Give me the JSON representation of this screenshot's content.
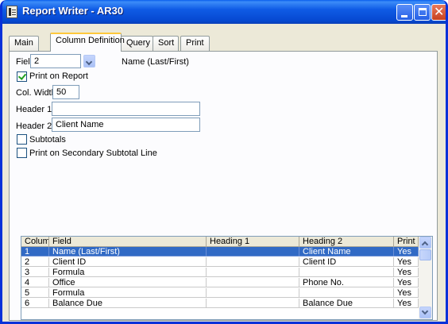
{
  "window": {
    "title": "Report Writer - AR30"
  },
  "tabs": [
    {
      "label": "Main"
    },
    {
      "label": "Column Definition",
      "active": true
    },
    {
      "label": "Query"
    },
    {
      "label": "Sort"
    },
    {
      "label": "Print"
    }
  ],
  "form": {
    "field_label": "Field:",
    "field_value": "2",
    "field_name": "Name (Last/First)",
    "print_on_report_label": "Print on Report",
    "print_on_report_checked": true,
    "col_width_label": "Col. Width:",
    "col_width_value": "50",
    "header1_label": "Header 1:",
    "header1_value": "",
    "header2_label": "Header 2:",
    "header2_value": "Client Name",
    "subtotals_label": "Subtotals",
    "subtotals_checked": false,
    "secondary_subtotal_label": "Print on Secondary Subtotal Line",
    "secondary_subtotal_checked": false
  },
  "grid": {
    "columns": [
      "Column",
      "Field",
      "Heading 1",
      "Heading 2",
      "Print"
    ],
    "rows": [
      [
        "1",
        "Name (Last/First)",
        "",
        "Client Name",
        "Yes"
      ],
      [
        "2",
        "Client ID",
        "",
        "Client ID",
        "Yes"
      ],
      [
        "3",
        "Formula",
        "",
        "",
        "Yes"
      ],
      [
        "4",
        "Office",
        "",
        "Phone No.",
        "Yes"
      ],
      [
        "5",
        "Formula",
        "",
        "",
        "Yes"
      ],
      [
        "6",
        "Balance Due",
        "",
        "Balance Due",
        "Yes"
      ]
    ],
    "selected_row": 0
  },
  "colors": {
    "titlebar": "#0a5fec",
    "selection": "#316ac5",
    "close_button": "#c7411f"
  },
  "icons": [
    "app-icon",
    "minimize-icon",
    "maximize-icon",
    "close-icon",
    "dropdown-arrow-icon",
    "scroll-up-icon",
    "scroll-down-icon"
  ]
}
